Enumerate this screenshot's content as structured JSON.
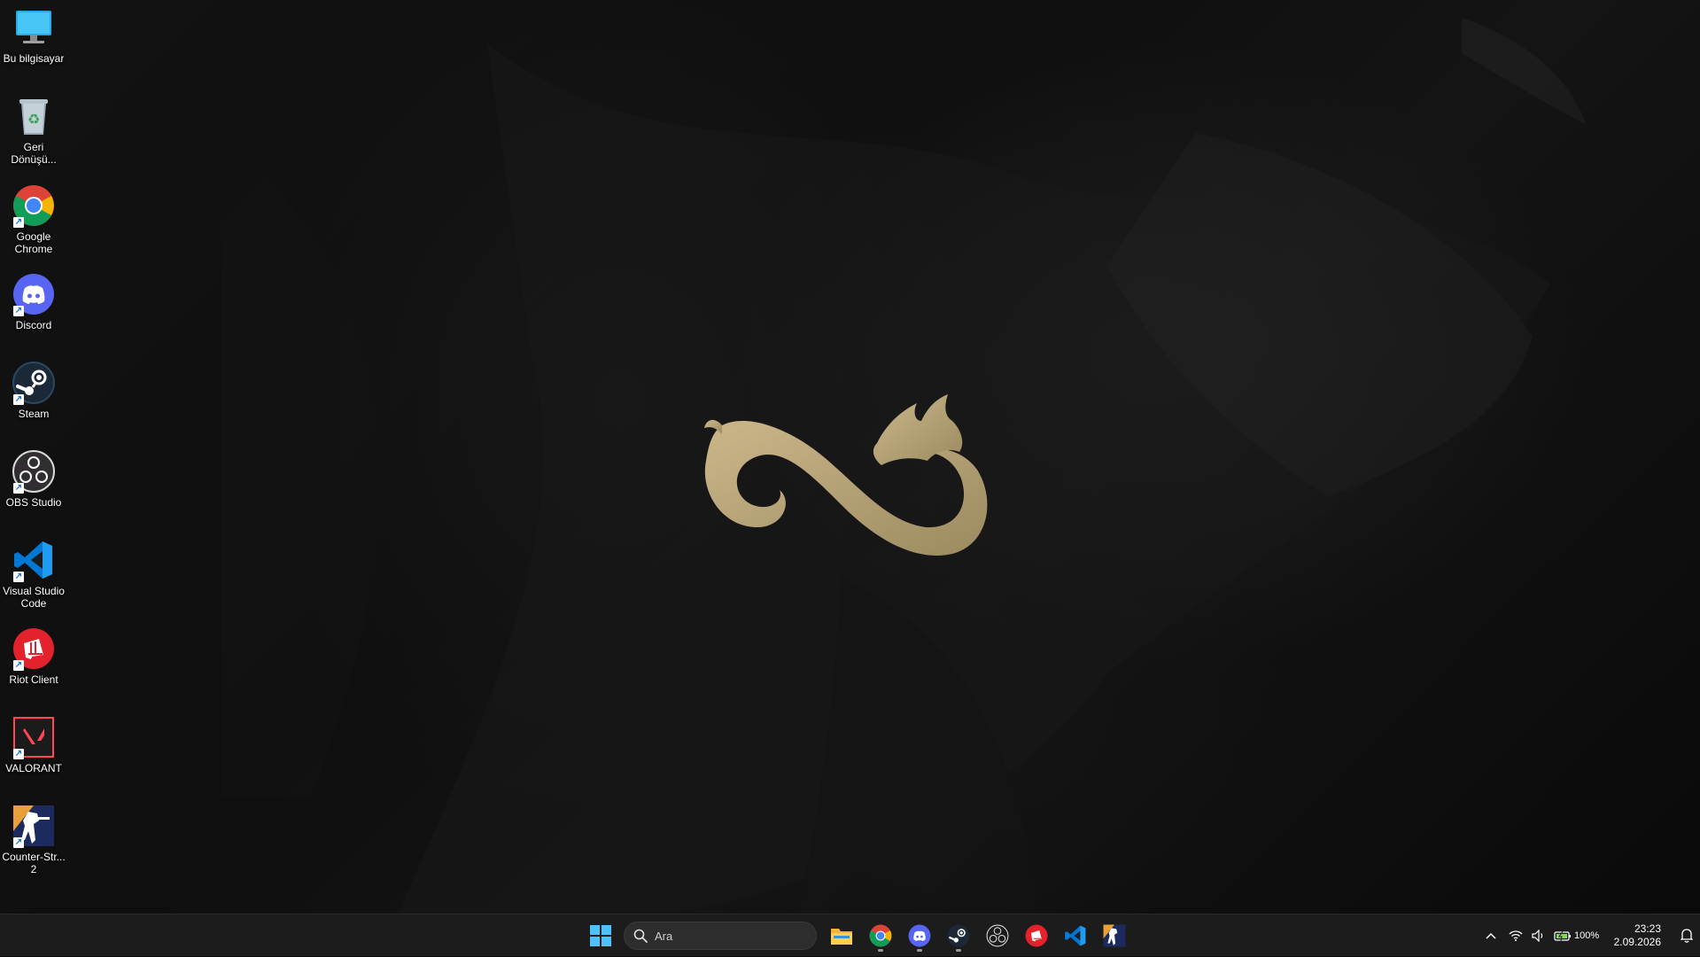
{
  "desktop": {
    "icons": [
      {
        "name": "this-pc-icon",
        "label": "Bu bilgisayar"
      },
      {
        "name": "recycle-bin-icon",
        "label": "Geri Dönüşü..."
      },
      {
        "name": "chrome-icon",
        "label": "Google Chrome"
      },
      {
        "name": "discord-icon",
        "label": "Discord"
      },
      {
        "name": "steam-icon",
        "label": "Steam"
      },
      {
        "name": "obs-icon",
        "label": "OBS Studio"
      },
      {
        "name": "vscode-icon",
        "label": "Visual Studio Code"
      },
      {
        "name": "riot-client-icon",
        "label": "Riot Client"
      },
      {
        "name": "valorant-icon",
        "label": "VALORANT"
      },
      {
        "name": "counter-strike-icon",
        "label": "Counter-Str... 2"
      }
    ]
  },
  "taskbar": {
    "search_placeholder": "Ara",
    "pinned": [
      "start-icon",
      "file-explorer-icon",
      "chrome-icon",
      "discord-icon",
      "steam-icon",
      "obs-icon",
      "riot-client-icon",
      "vscode-icon",
      "counter-strike-icon"
    ],
    "tray": {
      "battery": "100%",
      "time": "23:23",
      "date": "2.09.2026"
    }
  },
  "colors": {
    "taskbar_bg": "#1c1c1c",
    "logo_gold": "#b8a57a",
    "search_bg": "#2d2d2d"
  }
}
